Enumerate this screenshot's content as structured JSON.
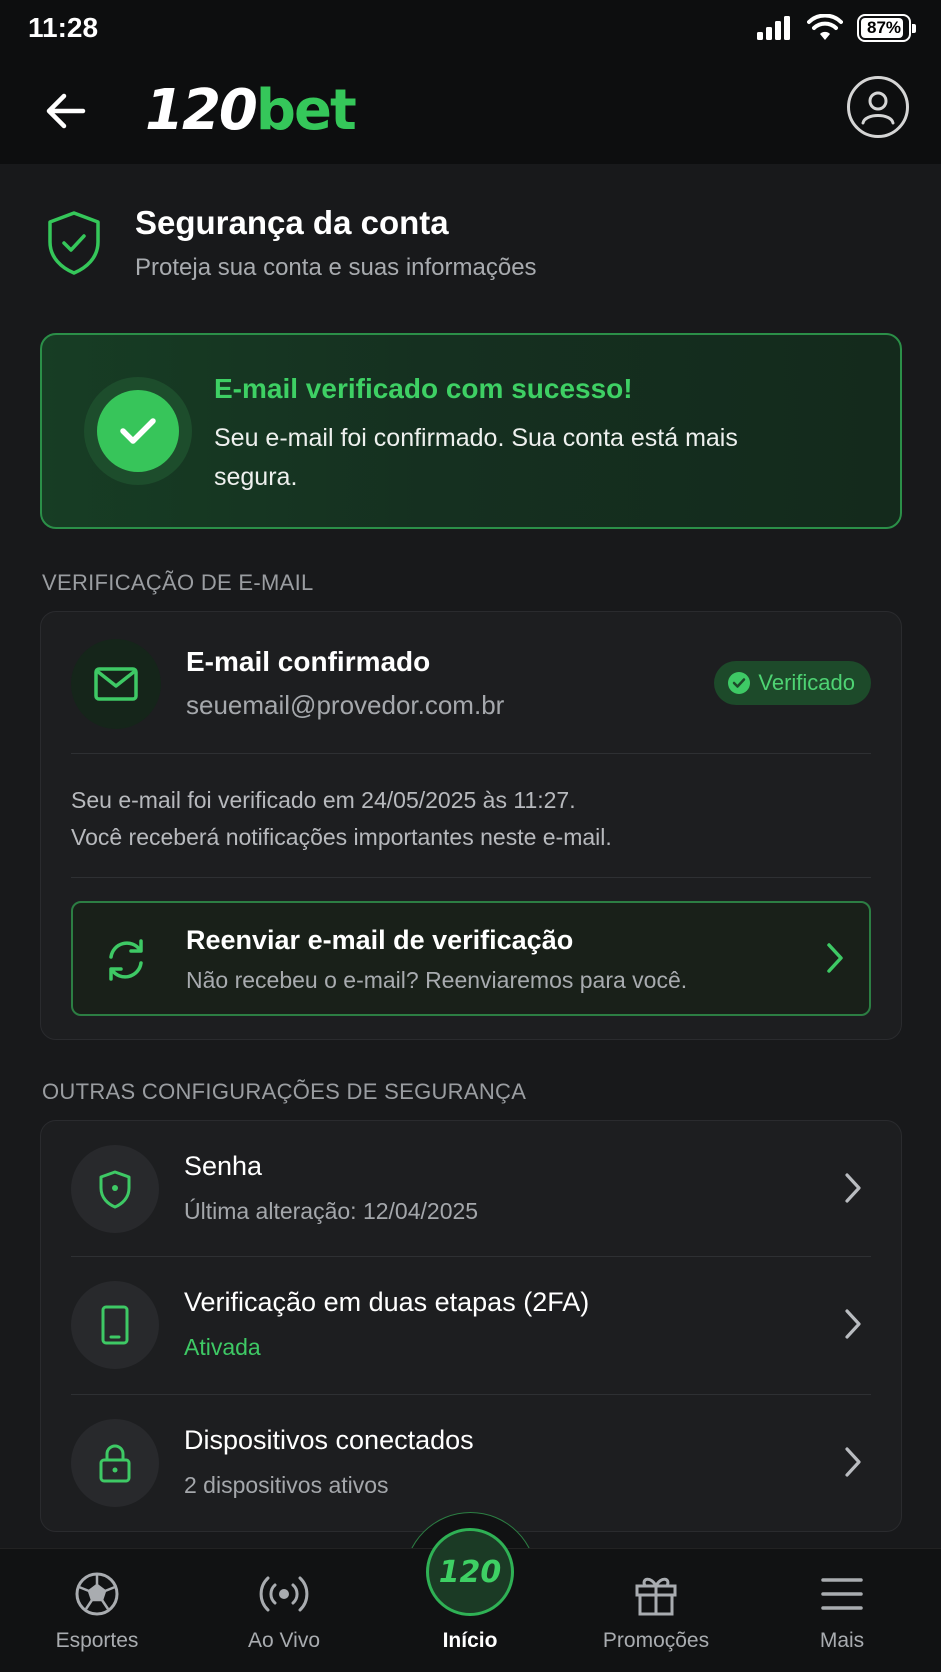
{
  "status_bar": {
    "time": "11:28",
    "battery": "87%"
  },
  "header": {
    "logo_number": "120",
    "logo_brand": "bet"
  },
  "page": {
    "title": "Segurança da conta",
    "subtitle": "Proteja sua conta e suas informações"
  },
  "success": {
    "title": "E-mail verificado com sucesso!",
    "message": "Seu e-mail foi confirmado. Sua conta está mais segura."
  },
  "email_section": {
    "label": "VERIFICAÇÃO DE E-MAIL",
    "title": "E-mail confirmado",
    "address": "seuemail@provedor.com.br",
    "badge": "Verificado",
    "info_line1": "Seu e-mail foi verificado em 24/05/2025 às 11:27.",
    "info_line2": "Você receberá notificações importantes neste e-mail.",
    "resend_title": "Reenviar e-mail de verificação",
    "resend_subtitle": "Não recebeu o e-mail? Reenviaremos para você."
  },
  "other_section": {
    "label": "OUTRAS CONFIGURAÇÕES DE SEGURANÇA",
    "items": [
      {
        "title": "Senha",
        "subtitle": "Última alteração: 12/04/2025",
        "icon": "shield-icon"
      },
      {
        "title": "Verificação em duas etapas (2FA)",
        "subtitle": "Ativada",
        "icon": "smartphone-icon"
      },
      {
        "title": "Dispositivos conectados",
        "subtitle": "2 dispositivos ativos",
        "icon": "lock-icon"
      }
    ]
  },
  "bottom_nav": {
    "items": [
      {
        "label": "Esportes",
        "icon": "soccer-ball-icon"
      },
      {
        "label": "Ao Vivo",
        "icon": "live-icon"
      },
      {
        "label": "Início",
        "icon": "home-logo-icon"
      },
      {
        "label": "Promoções",
        "icon": "gift-icon"
      },
      {
        "label": "Mais",
        "icon": "menu-icon"
      }
    ],
    "center_logo": "120"
  },
  "colors": {
    "accent": "#3ec965",
    "background": "#18191b",
    "card": "#1d1e20"
  }
}
